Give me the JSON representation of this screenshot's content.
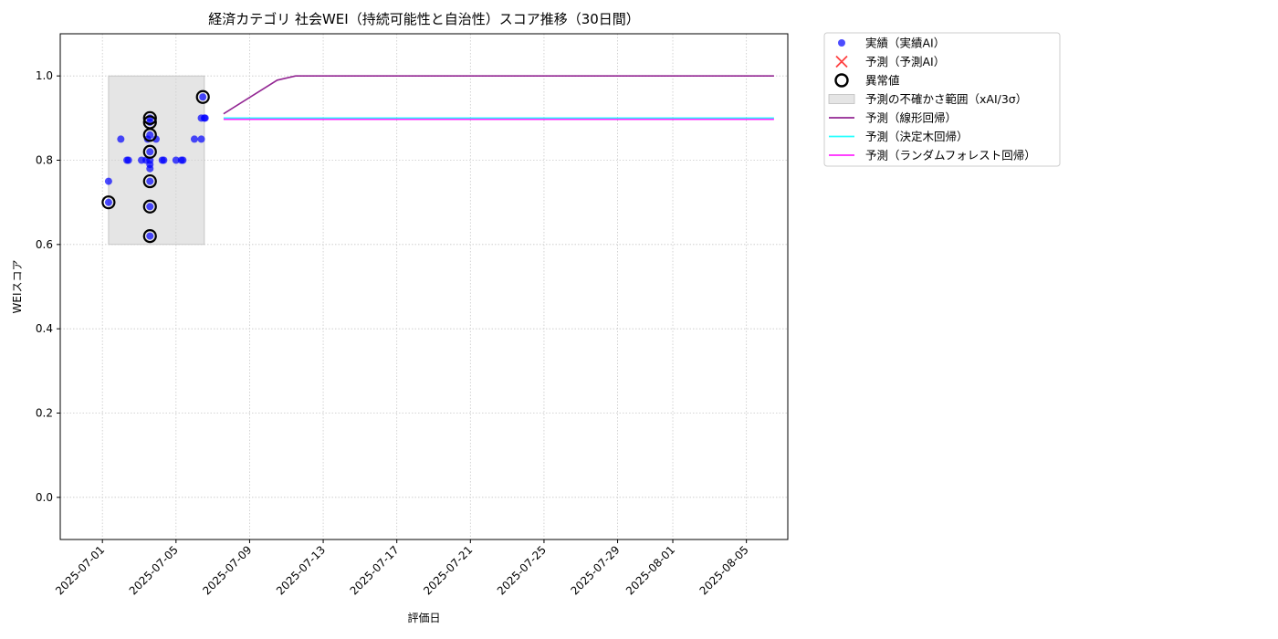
{
  "chart_data": {
    "type": "scatter",
    "title": "経済カテゴリ 社会WEI（持続可能性と自治性）スコア推移（30日間）",
    "xlabel": "評価日",
    "ylabel": "WEIスコア",
    "xlim": [
      "2025-06-28T17:00",
      "2025-08-07T06:00"
    ],
    "ylim": [
      -0.1,
      1.1
    ],
    "x_ticks": [
      "2025-07-01",
      "2025-07-05",
      "2025-07-09",
      "2025-07-13",
      "2025-07-17",
      "2025-07-21",
      "2025-07-25",
      "2025-07-29",
      "2025-08-01",
      "2025-08-05"
    ],
    "y_ticks": [
      0.0,
      0.2,
      0.4,
      0.6,
      0.8,
      1.0
    ],
    "grid": true,
    "legend_position": "outside-top-right",
    "uncertainty_band": {
      "name": "予測の不確かさ範囲（xAI/3σ）",
      "x": [
        "2025-07-01T08:00",
        "2025-07-06T13:00"
      ],
      "y": [
        0.6,
        1.0
      ],
      "color": "#d3d3d3"
    },
    "series": [
      {
        "name": "実績（実績AI）",
        "kind": "scatter",
        "color": "#0000ff",
        "points": [
          {
            "x": "2025-07-01T08:00",
            "y": 0.75
          },
          {
            "x": "2025-07-01T08:00",
            "y": 0.7
          },
          {
            "x": "2025-07-02T00:00",
            "y": 0.85
          },
          {
            "x": "2025-07-02T08:00",
            "y": 0.8
          },
          {
            "x": "2025-07-02T10:00",
            "y": 0.8
          },
          {
            "x": "2025-07-03T03:00",
            "y": 0.8
          },
          {
            "x": "2025-07-03T09:00",
            "y": 0.8
          },
          {
            "x": "2025-07-03T11:00",
            "y": 0.85
          },
          {
            "x": "2025-07-03T14:00",
            "y": 0.9
          },
          {
            "x": "2025-07-03T14:00",
            "y": 0.89
          },
          {
            "x": "2025-07-03T14:00",
            "y": 0.86
          },
          {
            "x": "2025-07-03T14:00",
            "y": 0.82
          },
          {
            "x": "2025-07-03T14:00",
            "y": 0.8
          },
          {
            "x": "2025-07-03T14:00",
            "y": 0.79
          },
          {
            "x": "2025-07-03T14:00",
            "y": 0.78
          },
          {
            "x": "2025-07-03T14:00",
            "y": 0.75
          },
          {
            "x": "2025-07-03T14:00",
            "y": 0.69
          },
          {
            "x": "2025-07-03T14:00",
            "y": 0.62
          },
          {
            "x": "2025-07-03T22:00",
            "y": 0.85
          },
          {
            "x": "2025-07-04T06:00",
            "y": 0.8
          },
          {
            "x": "2025-07-04T08:00",
            "y": 0.8
          },
          {
            "x": "2025-07-05T00:00",
            "y": 0.8
          },
          {
            "x": "2025-07-05T07:00",
            "y": 0.8
          },
          {
            "x": "2025-07-05T09:00",
            "y": 0.8
          },
          {
            "x": "2025-07-06T00:00",
            "y": 0.85
          },
          {
            "x": "2025-07-06T09:00",
            "y": 0.9
          },
          {
            "x": "2025-07-06T09:00",
            "y": 0.85
          },
          {
            "x": "2025-07-06T11:00",
            "y": 0.95
          },
          {
            "x": "2025-07-06T13:00",
            "y": 0.9
          },
          {
            "x": "2025-07-06T14:00",
            "y": 0.9
          }
        ]
      },
      {
        "name": "予測（予測AI）",
        "kind": "scatter-x",
        "color": "#ff0000",
        "points": []
      },
      {
        "name": "異常値",
        "kind": "outlier",
        "color": "#000000",
        "points": [
          {
            "x": "2025-07-01T08:00",
            "y": 0.7
          },
          {
            "x": "2025-07-03T14:00",
            "y": 0.9
          },
          {
            "x": "2025-07-03T14:00",
            "y": 0.89
          },
          {
            "x": "2025-07-03T14:00",
            "y": 0.86
          },
          {
            "x": "2025-07-03T14:00",
            "y": 0.82
          },
          {
            "x": "2025-07-03T14:00",
            "y": 0.75
          },
          {
            "x": "2025-07-03T14:00",
            "y": 0.69
          },
          {
            "x": "2025-07-03T14:00",
            "y": 0.62
          },
          {
            "x": "2025-07-06T11:00",
            "y": 0.95
          }
        ]
      },
      {
        "name": "予測（線形回帰）",
        "kind": "line",
        "color": "#800080",
        "points": [
          {
            "x": "2025-07-07T14:00",
            "y": 0.91
          },
          {
            "x": "2025-07-10T12:00",
            "y": 0.99
          },
          {
            "x": "2025-07-11T12:00",
            "y": 1.0
          },
          {
            "x": "2025-08-06T12:00",
            "y": 1.0
          }
        ]
      },
      {
        "name": "予測（決定木回帰）",
        "kind": "line",
        "color": "#00ffff",
        "points": [
          {
            "x": "2025-07-07T14:00",
            "y": 0.9
          },
          {
            "x": "2025-08-06T12:00",
            "y": 0.9
          }
        ]
      },
      {
        "name": "予測（ランダムフォレスト回帰）",
        "kind": "line",
        "color": "#ff00ff",
        "points": [
          {
            "x": "2025-07-07T14:00",
            "y": 0.897
          },
          {
            "x": "2025-08-06T12:00",
            "y": 0.897
          }
        ]
      }
    ]
  }
}
